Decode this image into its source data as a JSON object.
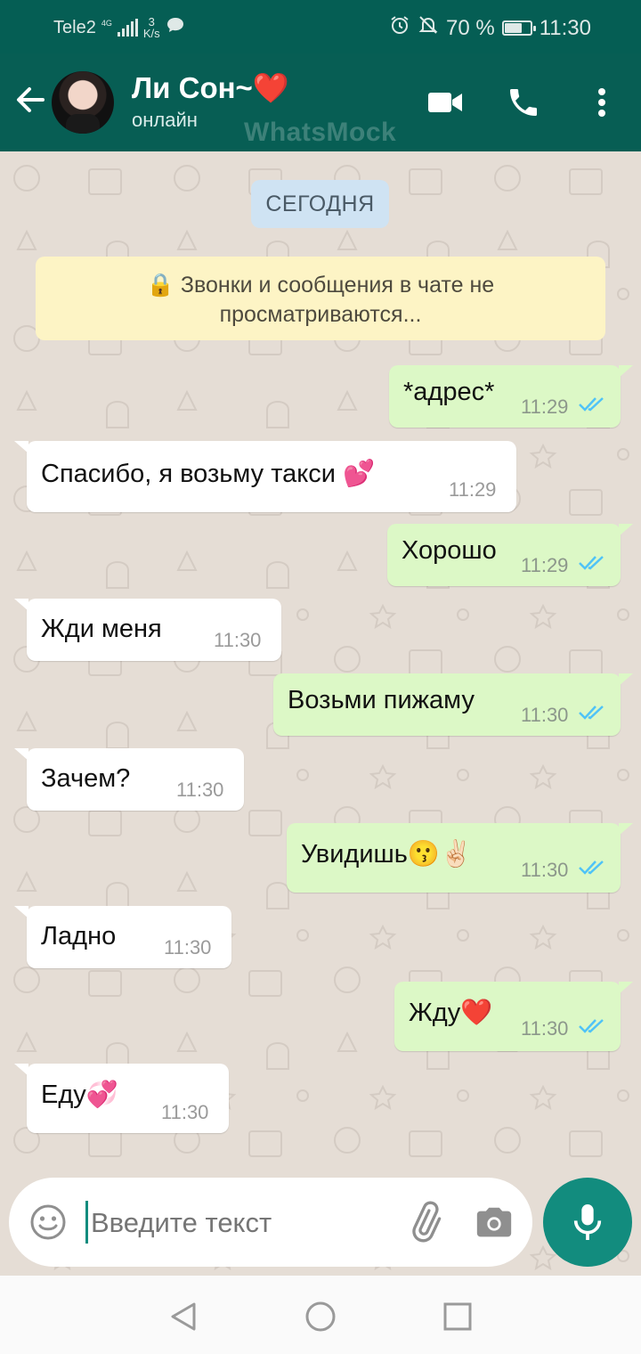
{
  "status_bar": {
    "carrier": "Tele2",
    "network": "4G",
    "speed_value": "3",
    "speed_unit": "K/s",
    "battery": "70 %",
    "battery_level": 0.7,
    "time": "11:30"
  },
  "header": {
    "contact_name": "Ли Сон~❤️",
    "contact_status": "онлайн",
    "watermark": "WhatsMock"
  },
  "chat": {
    "date_chip": "СЕГОДНЯ",
    "encryption_notice": "🔒 Звонки и сообщения в чате не просматриваются...",
    "messages": [
      {
        "dir": "out",
        "text": "*адрес*",
        "time": "11:29",
        "status": "read"
      },
      {
        "dir": "in",
        "text": "Спасибо, я возьму такси 💕",
        "time": "11:29"
      },
      {
        "dir": "out",
        "text": "Хорошо",
        "time": "11:29",
        "status": "read"
      },
      {
        "dir": "in",
        "text": "Жди меня",
        "time": "11:30"
      },
      {
        "dir": "out",
        "text": "Возьми пижаму",
        "time": "11:30",
        "status": "read"
      },
      {
        "dir": "in",
        "text": "Зачем?",
        "time": "11:30"
      },
      {
        "dir": "out",
        "text": "Увидишь😗✌🏻",
        "time": "11:30",
        "status": "read"
      },
      {
        "dir": "in",
        "text": "Ладно",
        "time": "11:30"
      },
      {
        "dir": "out",
        "text": "Жду❤️",
        "time": "11:30",
        "status": "read"
      },
      {
        "dir": "in",
        "text": "Еду💞",
        "time": "11:30"
      }
    ]
  },
  "composer": {
    "placeholder": "Введите текст"
  },
  "colors": {
    "header": "#075e54",
    "outgoing_bubble": "#dcf8c6",
    "incoming_bubble": "#ffffff",
    "read_ticks": "#4fc3f7",
    "accent": "#128c7e"
  }
}
